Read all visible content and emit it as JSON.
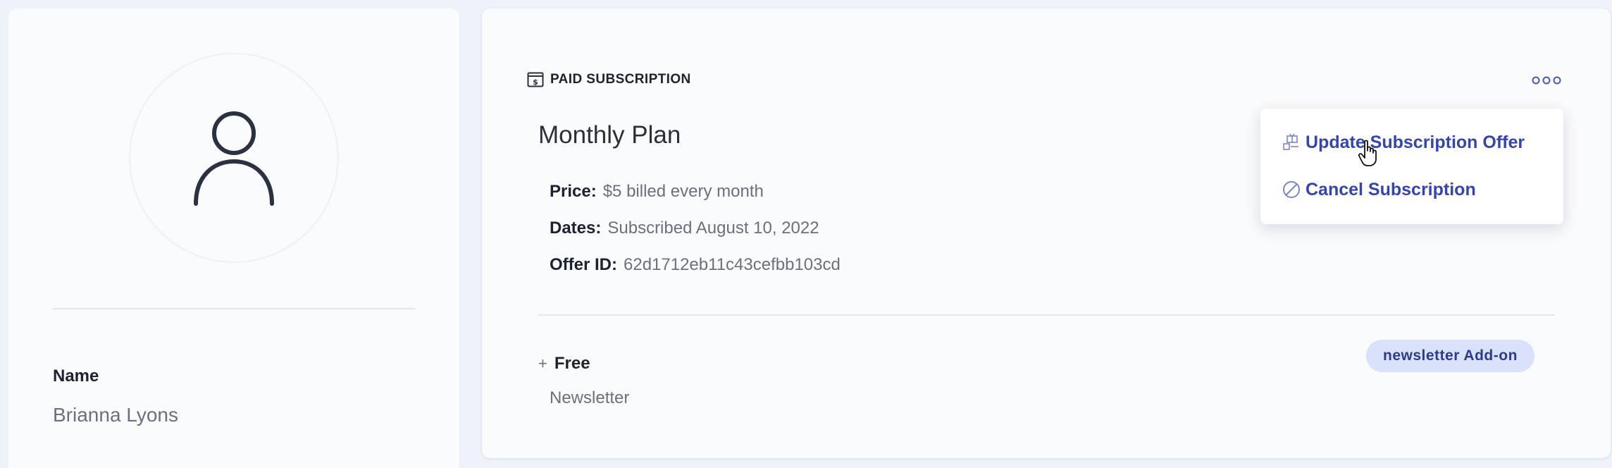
{
  "profile": {
    "name_label": "Name",
    "name_value": "Brianna Lyons",
    "avatar_icon": "user-icon"
  },
  "subscription": {
    "header_icon": "dollar-bill-icon",
    "header_label": "PAID SUBSCRIPTION",
    "more_icon": "more-horizontal-icon",
    "plan_name": "Monthly Plan",
    "details": {
      "price_label": "Price:",
      "price_value": "$5 billed every month",
      "dates_label": "Dates:",
      "dates_value": "Subscribed August 10, 2022",
      "offer_label": "Offer ID:",
      "offer_value": "62d1712eb11c43cefbb103cd"
    },
    "addon": {
      "plus": "+",
      "name": "Free",
      "description": "Newsletter",
      "badge": "newsletter Add-on"
    }
  },
  "menu": {
    "items": [
      {
        "label": "Update Subscription Offer",
        "icon": "gift-icon"
      },
      {
        "label": "Cancel Subscription",
        "icon": "cancel-circle-icon"
      }
    ]
  },
  "colors": {
    "page_bg": "#eef2fa",
    "card_bg": "#fafbfc",
    "menu_text": "#3545b0",
    "badge_bg": "#d9e1fb",
    "badge_text": "#2d3b8e"
  }
}
